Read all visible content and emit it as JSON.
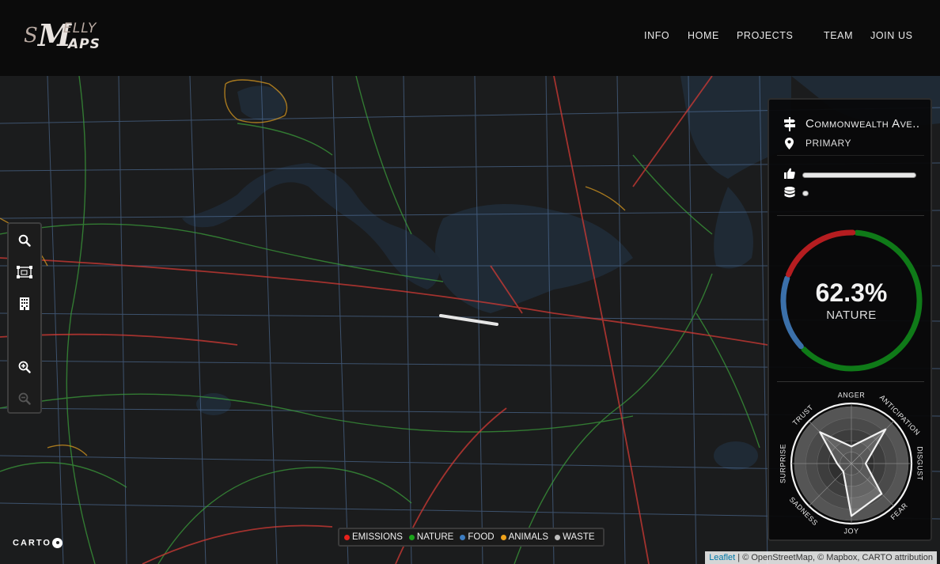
{
  "header": {
    "logo": {
      "s": "S",
      "m": "M",
      "elly": "ELLY",
      "aps": "APS"
    },
    "nav": [
      "INFO",
      "HOME",
      "PROJECTS",
      "TEAM",
      "JOIN US"
    ]
  },
  "toolbar": {
    "tools": [
      "search-icon",
      "select-area-icon",
      "building-icon",
      "zoom-in-icon",
      "zoom-out-icon"
    ]
  },
  "panel": {
    "street_name": "Commonwealth Ave..",
    "road_type": "PRIMARY",
    "likes_level": 1.0,
    "data_level": 0.05,
    "smell_percent": "62.3%",
    "smell_label": "NATURE",
    "donut": {
      "emissions_share": 0.2,
      "nature_share": 0.62,
      "food_share": 0.18
    },
    "emotions": [
      "ANGER",
      "ANTICIPATION",
      "DISGUST",
      "FEAR",
      "JOY",
      "SADNESS",
      "SURPRISE",
      "TRUST"
    ],
    "emotion_values": [
      0.3,
      0.85,
      0.25,
      0.75,
      0.92,
      0.2,
      0.25,
      0.78
    ]
  },
  "legend": [
    {
      "label": "EMISSIONS",
      "color": "#e8211c"
    },
    {
      "label": "NATURE",
      "color": "#1aa31a"
    },
    {
      "label": "FOOD",
      "color": "#3c7cc0"
    },
    {
      "label": "ANIMALS",
      "color": "#f0a21a"
    },
    {
      "label": "WASTE",
      "color": "#bdbdbd"
    }
  ],
  "carto_logo": "CARTO",
  "attribution": {
    "leaflet": "Leaflet",
    "rest": " | © OpenStreetMap, © Mapbox, CARTO attribution"
  }
}
